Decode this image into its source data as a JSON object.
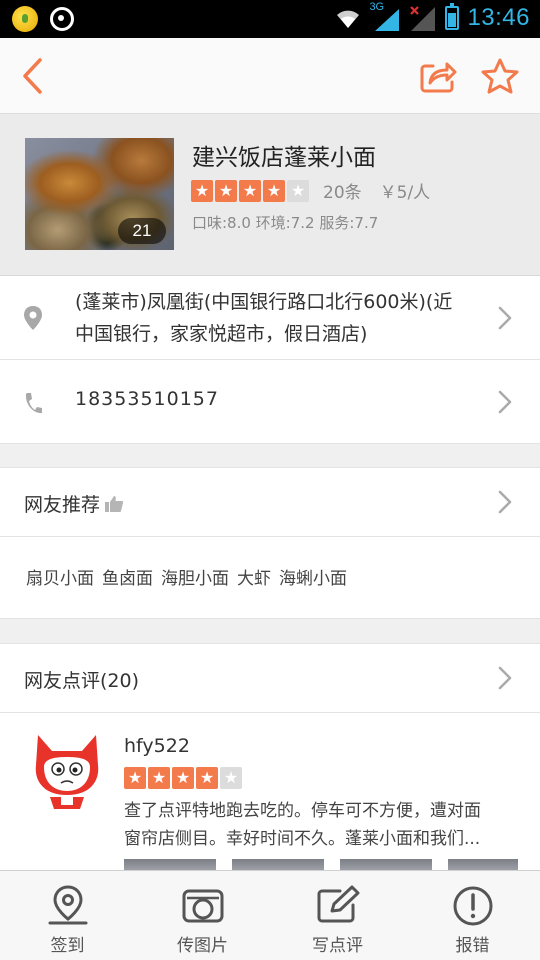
{
  "status_bar": {
    "network": "3G",
    "time": "13:46",
    "accent_color": "#33b5e5"
  },
  "nav": {
    "back_icon": "back-arrow-icon",
    "share_icon": "share-icon",
    "favorite_icon": "star-outline-icon",
    "accent_color": "#f27a4b"
  },
  "shop": {
    "name": "建兴饭店蓬莱小面",
    "photo_count": "21",
    "rating_stars": 4,
    "rating_max": 5,
    "review_count": "20条",
    "avg_price": "￥5/人",
    "scores": "口味:8.0 环境:7.2 服务:7.7"
  },
  "address": {
    "icon": "location-pin-icon",
    "line1": "(蓬莱市)凤凰街(中国银行路口北行600米)(近",
    "line2": "中国银行，家家悦超市，假日酒店)"
  },
  "phone": {
    "icon": "phone-icon",
    "number": "18353510157"
  },
  "recommend": {
    "title": "网友推荐",
    "icon": "thumbs-up-icon",
    "dishes": [
      "扇贝小面",
      "鱼卤面",
      "海胆小面",
      "大虾",
      "海蜊小面"
    ]
  },
  "reviews": {
    "title": "网友点评(20)",
    "items": [
      {
        "user": "hfy522",
        "stars": 4,
        "text_line1": "查了点评特地跑去吃的。停车可不方便，遭对面",
        "text_line2": "窗帘店侧目。幸好时间不久。蓬莱小面和我们..."
      }
    ]
  },
  "tabbar": {
    "items": [
      {
        "label": "签到",
        "icon": "checkin-pin-icon"
      },
      {
        "label": "传图片",
        "icon": "camera-icon"
      },
      {
        "label": "写点评",
        "icon": "edit-review-icon"
      },
      {
        "label": "报错",
        "icon": "error-report-icon"
      }
    ]
  }
}
